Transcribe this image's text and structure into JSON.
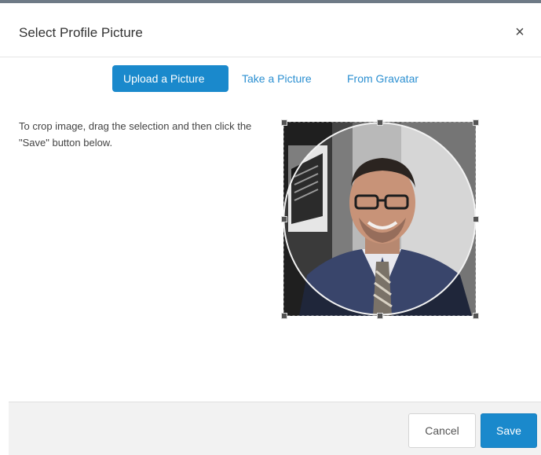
{
  "dialog": {
    "title": "Select Profile Picture",
    "close_glyph": "×"
  },
  "tabs": [
    {
      "label": "Upload a Picture",
      "active": true
    },
    {
      "label": "Take a Picture",
      "active": false
    },
    {
      "label": "From Gravatar",
      "active": false
    }
  ],
  "crop": {
    "instructions": "To crop image, drag the selection and then click the \"Save\" button below."
  },
  "footer": {
    "cancel_label": "Cancel",
    "save_label": "Save"
  },
  "colors": {
    "accent": "#1a89cc",
    "link": "#2b8fd1"
  }
}
